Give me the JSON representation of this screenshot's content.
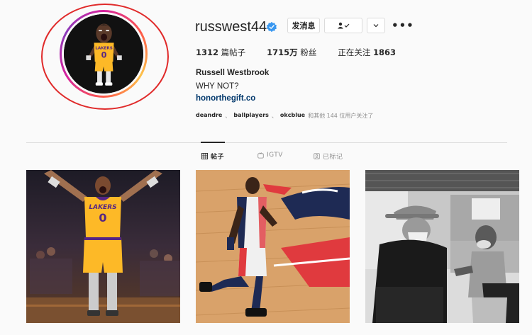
{
  "profile": {
    "username": "russwest44",
    "message_button": "发消息",
    "stats": {
      "posts_count": "1312",
      "posts_label": "篇帖子",
      "followers_count": "1715万",
      "followers_label": "粉丝",
      "following_label": "正在关注",
      "following_count": "1863"
    },
    "full_name": "Russell Westbrook",
    "bio": "WHY NOT?",
    "website": "honorthegift.co",
    "followed_by": [
      "deandre",
      "ballplayers",
      "okcblue"
    ],
    "followed_by_suffix": "和其他 144 位用户关注了"
  },
  "tabs": [
    {
      "label": "帖子",
      "icon": "grid-icon",
      "active": true
    },
    {
      "label": "IGTV",
      "icon": "igtv-icon",
      "active": false
    },
    {
      "label": "已标记",
      "icon": "tag-icon",
      "active": false
    }
  ],
  "colors": {
    "verified": "#3897f0",
    "link": "#00376b",
    "annotation": "#e02a2a"
  }
}
